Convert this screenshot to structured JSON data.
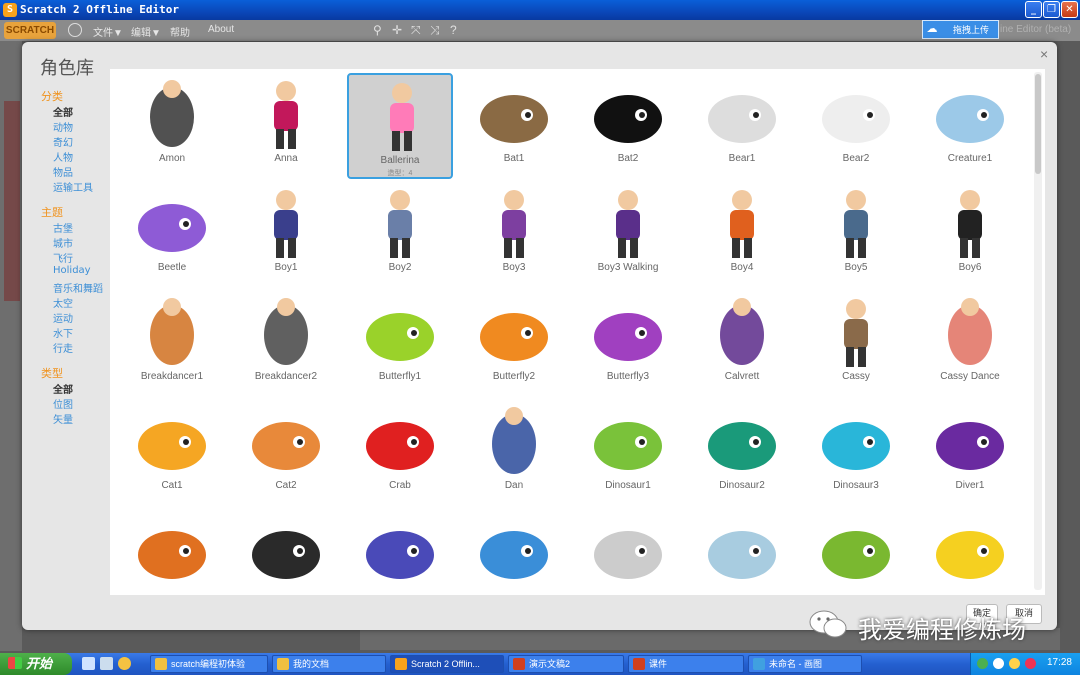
{
  "window": {
    "title": "Scratch 2 Offline Editor",
    "minimize": "_",
    "maximize": "❐",
    "close": "✕"
  },
  "menubar": {
    "logo": "SCRATCH",
    "file": "文件▼",
    "edit": "编辑▼",
    "help": "帮助",
    "about": "About",
    "tools": [
      "⚲",
      "✛",
      "⤧",
      "⤨",
      "?"
    ],
    "upload": "拖拽上传",
    "editor_title": "ine Editor (beta)"
  },
  "dialog": {
    "title": "角色库",
    "close": "×",
    "ok": "确定",
    "cancel": "取消"
  },
  "categories": {
    "category_label": "分类",
    "category_items": [
      "全部",
      "动物",
      "奇幻",
      "人物",
      "物品",
      "运输工具"
    ],
    "theme_label": "主题",
    "theme_items": [
      "古堡",
      "城市",
      "飞行",
      "Holiday",
      "音乐和舞蹈",
      "太空",
      "运动",
      "水下",
      "行走"
    ],
    "type_label": "类型",
    "type_items": [
      "全部",
      "位图",
      "矢量"
    ]
  },
  "sprites": [
    {
      "name": "Amon",
      "color": "#333333"
    },
    {
      "name": "Anna",
      "color": "#c2185b"
    },
    {
      "name": "Ballerina",
      "color": "#ff7bb8",
      "sub": "造型：4"
    },
    {
      "name": "Bat1",
      "color": "#8a6a44"
    },
    {
      "name": "Bat2",
      "color": "#111111"
    },
    {
      "name": "Bear1",
      "color": "#dddddd"
    },
    {
      "name": "Bear2",
      "color": "#eeeeee"
    },
    {
      "name": "Creature1",
      "color": "#9cc9e8"
    },
    {
      "name": "Beetle",
      "color": "#8e5bd6"
    },
    {
      "name": "Boy1",
      "color": "#3a3f8c"
    },
    {
      "name": "Boy2",
      "color": "#6a7fa8"
    },
    {
      "name": "Boy3",
      "color": "#7d3fa0"
    },
    {
      "name": "Boy3 Walking",
      "color": "#5a2f8a"
    },
    {
      "name": "Boy4",
      "color": "#e0601e"
    },
    {
      "name": "Boy5",
      "color": "#4a6a8c"
    },
    {
      "name": "Boy6",
      "color": "#222222"
    },
    {
      "name": "Breakdancer1",
      "color": "#d07020"
    },
    {
      "name": "Breakdancer2",
      "color": "#444444"
    },
    {
      "name": "Butterfly1",
      "color": "#9ad22a"
    },
    {
      "name": "Butterfly2",
      "color": "#f08a20"
    },
    {
      "name": "Butterfly3",
      "color": "#a040c0"
    },
    {
      "name": "Calvrett",
      "color": "#5a2a8a"
    },
    {
      "name": "Cassy",
      "color": "#8a6a4a"
    },
    {
      "name": "Cassy Dance",
      "color": "#e07060"
    },
    {
      "name": "Cat1",
      "color": "#f5a623"
    },
    {
      "name": "Cat2",
      "color": "#e8893a"
    },
    {
      "name": "Crab",
      "color": "#e02020"
    },
    {
      "name": "Dan",
      "color": "#2a4a9a"
    },
    {
      "name": "Dinosaur1",
      "color": "#7ac23a"
    },
    {
      "name": "Dinosaur2",
      "color": "#1a9a7a"
    },
    {
      "name": "Dinosaur3",
      "color": "#29b6d9"
    },
    {
      "name": "Diver1",
      "color": "#6a2aa0"
    },
    {
      "name": "",
      "color": "#e07020"
    },
    {
      "name": "",
      "color": "#2a2a2a"
    },
    {
      "name": "",
      "color": "#4a4ab8"
    },
    {
      "name": "",
      "color": "#3a8ed8"
    },
    {
      "name": "",
      "color": "#cccccc"
    },
    {
      "name": "",
      "color": "#a8cce0"
    },
    {
      "name": "",
      "color": "#7ab830"
    },
    {
      "name": "",
      "color": "#f5d020"
    }
  ],
  "watermark": "我爱编程修炼场",
  "taskbar": {
    "start": "开始",
    "tasks": [
      {
        "label": "scratch编程初体验",
        "color": "#f0c040"
      },
      {
        "label": "我的文档",
        "color": "#f0c040"
      },
      {
        "label": "Scratch 2 Offlin...",
        "color": "#f7a21b"
      },
      {
        "label": "演示文稿2",
        "color": "#d04020"
      },
      {
        "label": "课件",
        "color": "#d04020"
      },
      {
        "label": "未命名 - 画图",
        "color": "#40a0e0"
      }
    ],
    "clock": "17:28"
  }
}
